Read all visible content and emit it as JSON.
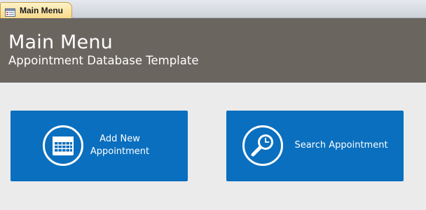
{
  "tab": {
    "label": "Main Menu",
    "icon": "form-icon"
  },
  "header": {
    "title": "Main Menu",
    "subtitle": "Appointment Database Template"
  },
  "tiles": [
    {
      "label": "Add New Appointment",
      "icon": "calendar-icon"
    },
    {
      "label": "Search Appointment",
      "icon": "search-clock-icon"
    }
  ],
  "colors": {
    "header_bg": "#6b6560",
    "tile_bg": "#0a6fbe",
    "page_bg": "#ebebeb",
    "tab_bg": "#f7d98a"
  }
}
